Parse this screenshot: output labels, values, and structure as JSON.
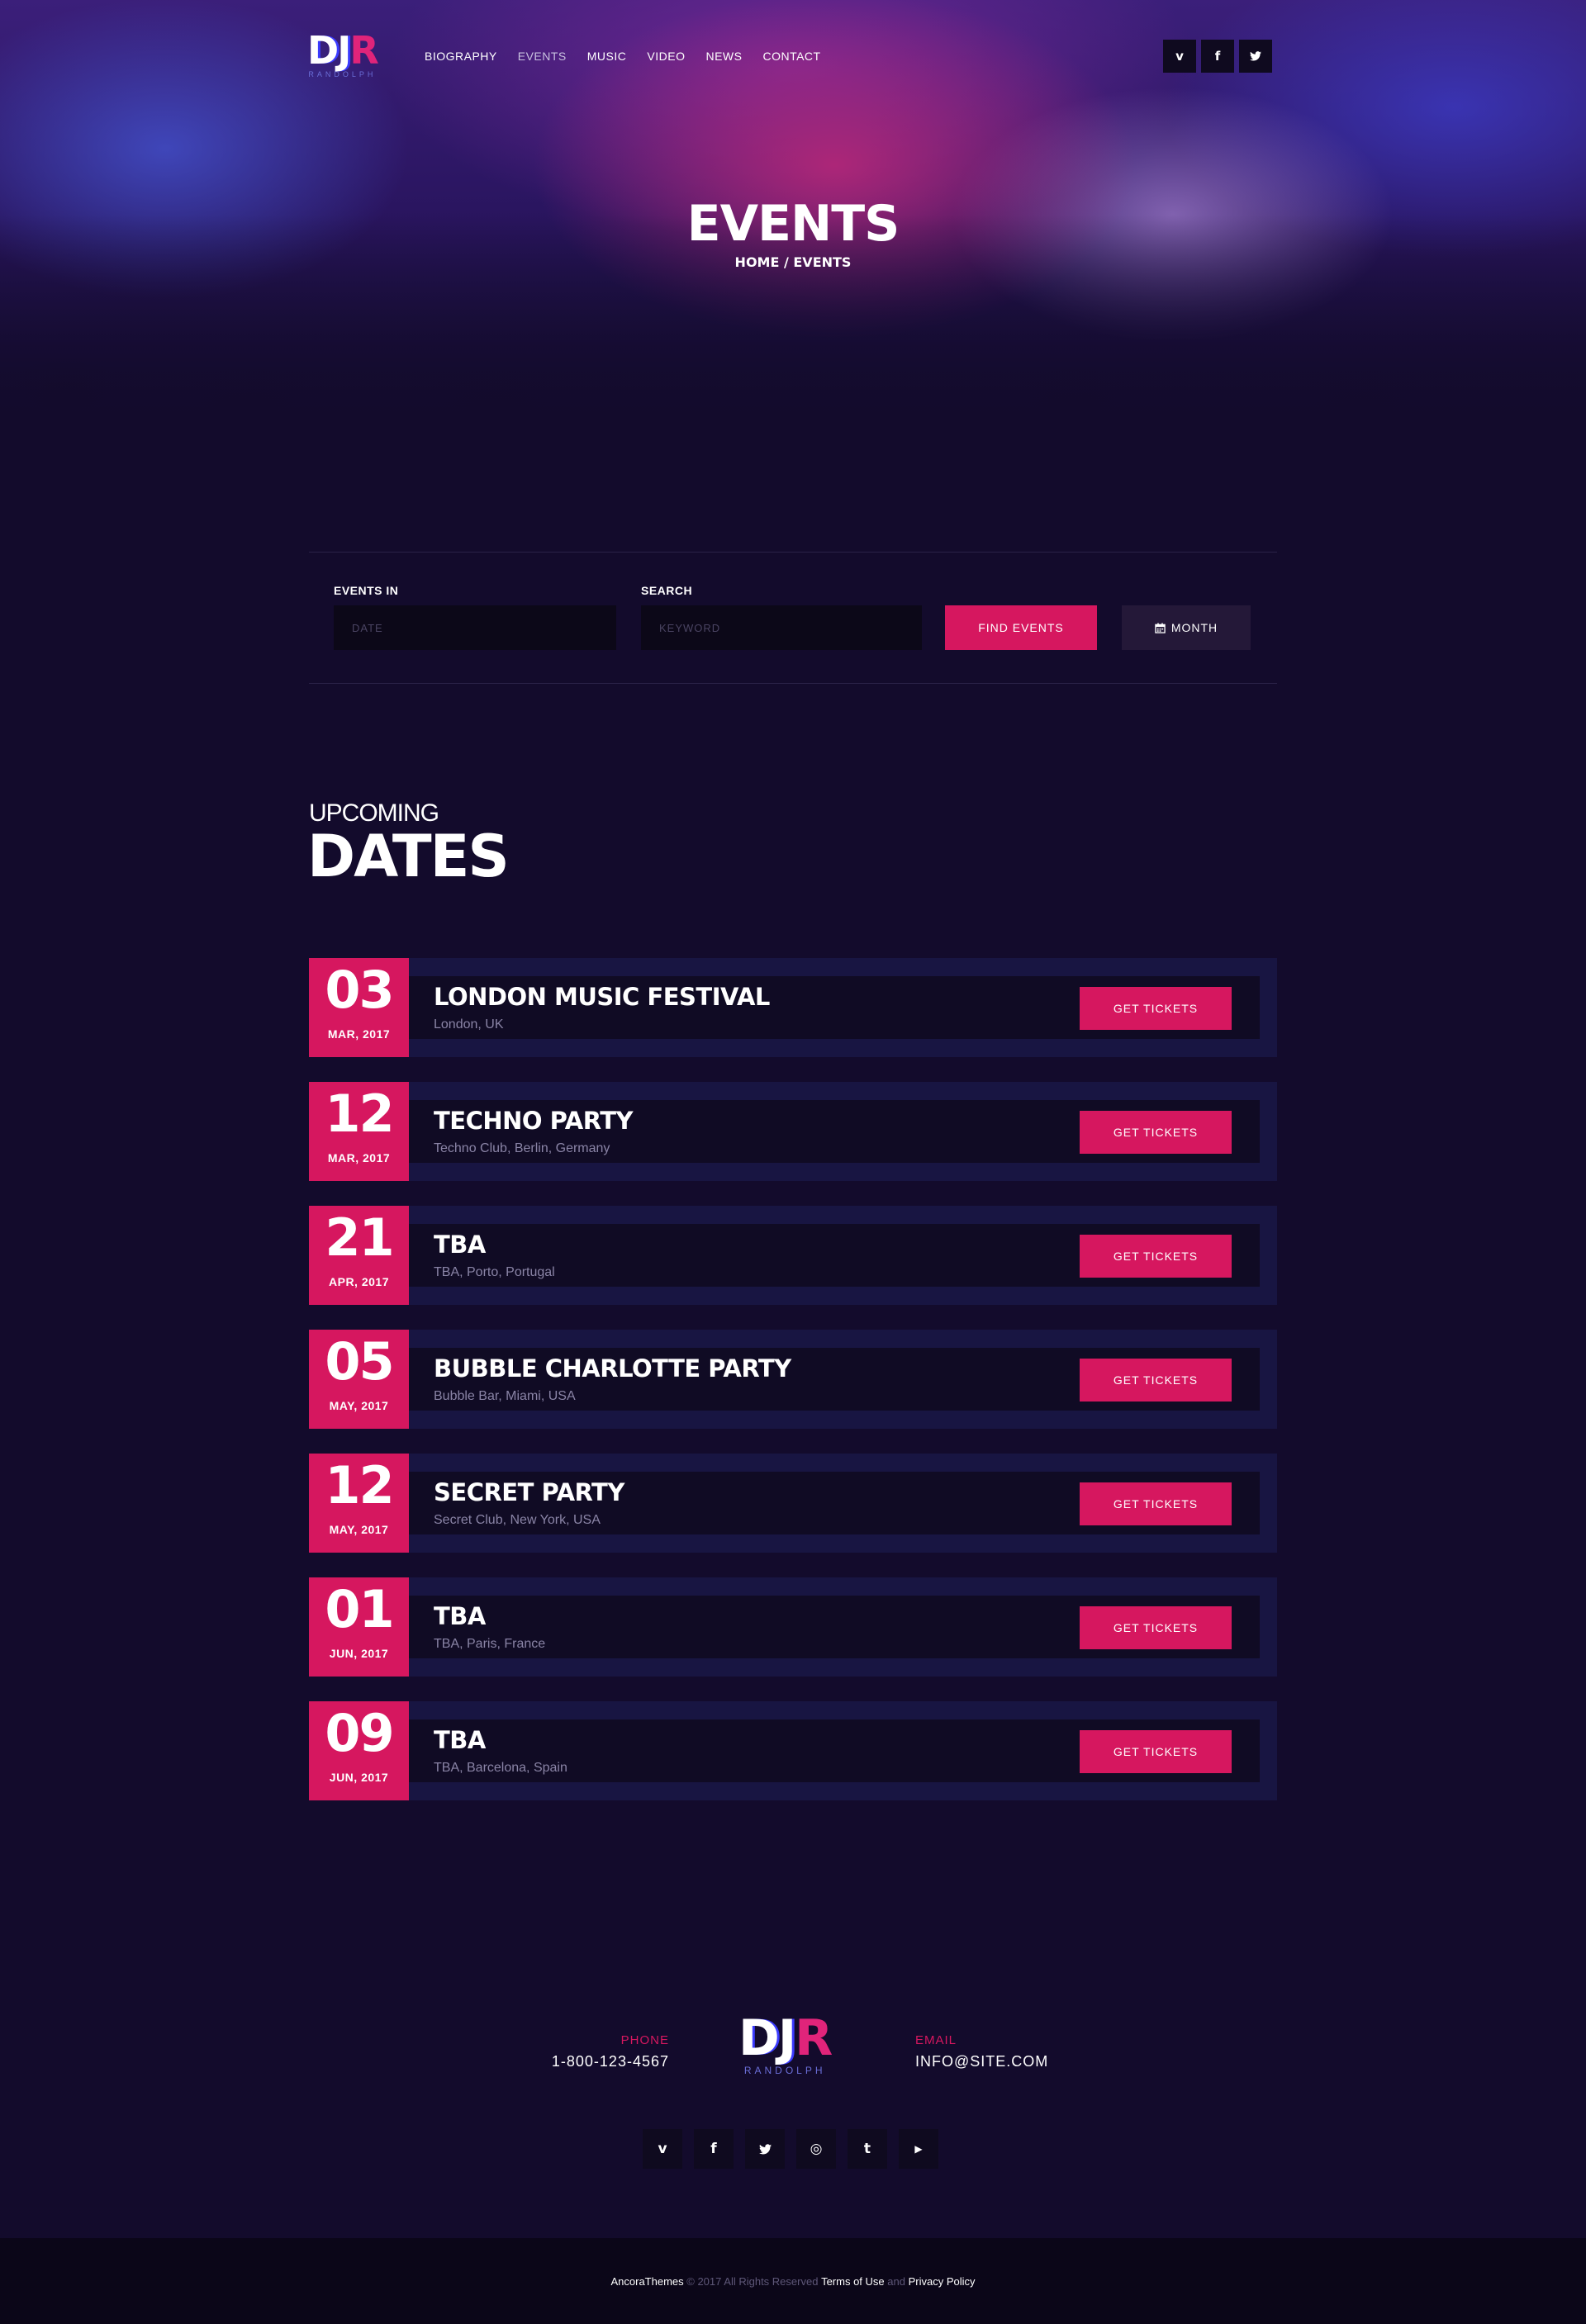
{
  "brand": {
    "logo_letters": [
      "D",
      "J",
      "R"
    ],
    "logo_sub": "RANDOLPH"
  },
  "nav": {
    "items": [
      {
        "label": "BIOGRAPHY",
        "active": false
      },
      {
        "label": "EVENTS",
        "active": true
      },
      {
        "label": "MUSIC",
        "active": false
      },
      {
        "label": "VIDEO",
        "active": false
      },
      {
        "label": "NEWS",
        "active": false
      },
      {
        "label": "CONTACT",
        "active": false
      }
    ]
  },
  "social_top": [
    {
      "icon": "vimeo-icon",
      "glyph": "v"
    },
    {
      "icon": "facebook-icon",
      "glyph": "f"
    },
    {
      "icon": "twitter-icon",
      "glyph": "t"
    }
  ],
  "page_title": "EVENTS",
  "breadcrumb": "HOME / EVENTS",
  "filter": {
    "events_in_label": "EVENTS IN",
    "date_placeholder": "DATE",
    "search_label": "SEARCH",
    "keyword_placeholder": "KEYWORD",
    "find_button": "FIND EVENTS",
    "view_button": "MONTH",
    "view_icon": "calendar-icon"
  },
  "section": {
    "subtitle": "UPCOMING",
    "title": "DATES"
  },
  "events": [
    {
      "day": "03",
      "month": "MAR, 2017",
      "name": "LONDON MUSIC FESTIVAL",
      "location": "London, UK",
      "button": "GET TICKETS"
    },
    {
      "day": "12",
      "month": "MAR, 2017",
      "name": "TECHNO PARTY",
      "location": "Techno Club, Berlin, Germany",
      "button": "GET TICKETS"
    },
    {
      "day": "21",
      "month": "APR, 2017",
      "name": "TBA",
      "location": "TBA, Porto, Portugal",
      "button": "GET TICKETS"
    },
    {
      "day": "05",
      "month": "MAY, 2017",
      "name": "BUBBLE CHARLOTTE PARTY",
      "location": "Bubble Bar, Miami, USA",
      "button": "GET TICKETS"
    },
    {
      "day": "12",
      "month": "MAY, 2017",
      "name": "SECRET PARTY",
      "location": "Secret Club, New York, USA",
      "button": "GET TICKETS"
    },
    {
      "day": "01",
      "month": "JUN, 2017",
      "name": "TBA",
      "location": "TBA, Paris, France",
      "button": "GET TICKETS"
    },
    {
      "day": "09",
      "month": "JUN, 2017",
      "name": "TBA",
      "location": "TBA, Barcelona, Spain",
      "button": "GET TICKETS"
    }
  ],
  "footer": {
    "phone_label": "PHONE",
    "phone": "1-800-123-4567",
    "email_label": "EMAIL",
    "email": "INFO@SITE.COM",
    "social": [
      {
        "icon": "vimeo-icon",
        "glyph": "v"
      },
      {
        "icon": "facebook-icon",
        "glyph": "f"
      },
      {
        "icon": "twitter-icon",
        "glyph": "t"
      },
      {
        "icon": "instagram-icon",
        "glyph": "◎"
      },
      {
        "icon": "tumblr-icon",
        "glyph": "t"
      },
      {
        "icon": "youtube-icon",
        "glyph": "▶"
      }
    ],
    "copyright_brand": "AncoraThemes",
    "copyright_text": "© 2017 All Rights Reserved",
    "terms": "Terms of Use",
    "and": "and",
    "privacy": "Privacy Policy"
  },
  "colors": {
    "accent": "#d6175f",
    "background": "#130b2c",
    "event_band": "#181542",
    "event_panel": "#100b24"
  }
}
